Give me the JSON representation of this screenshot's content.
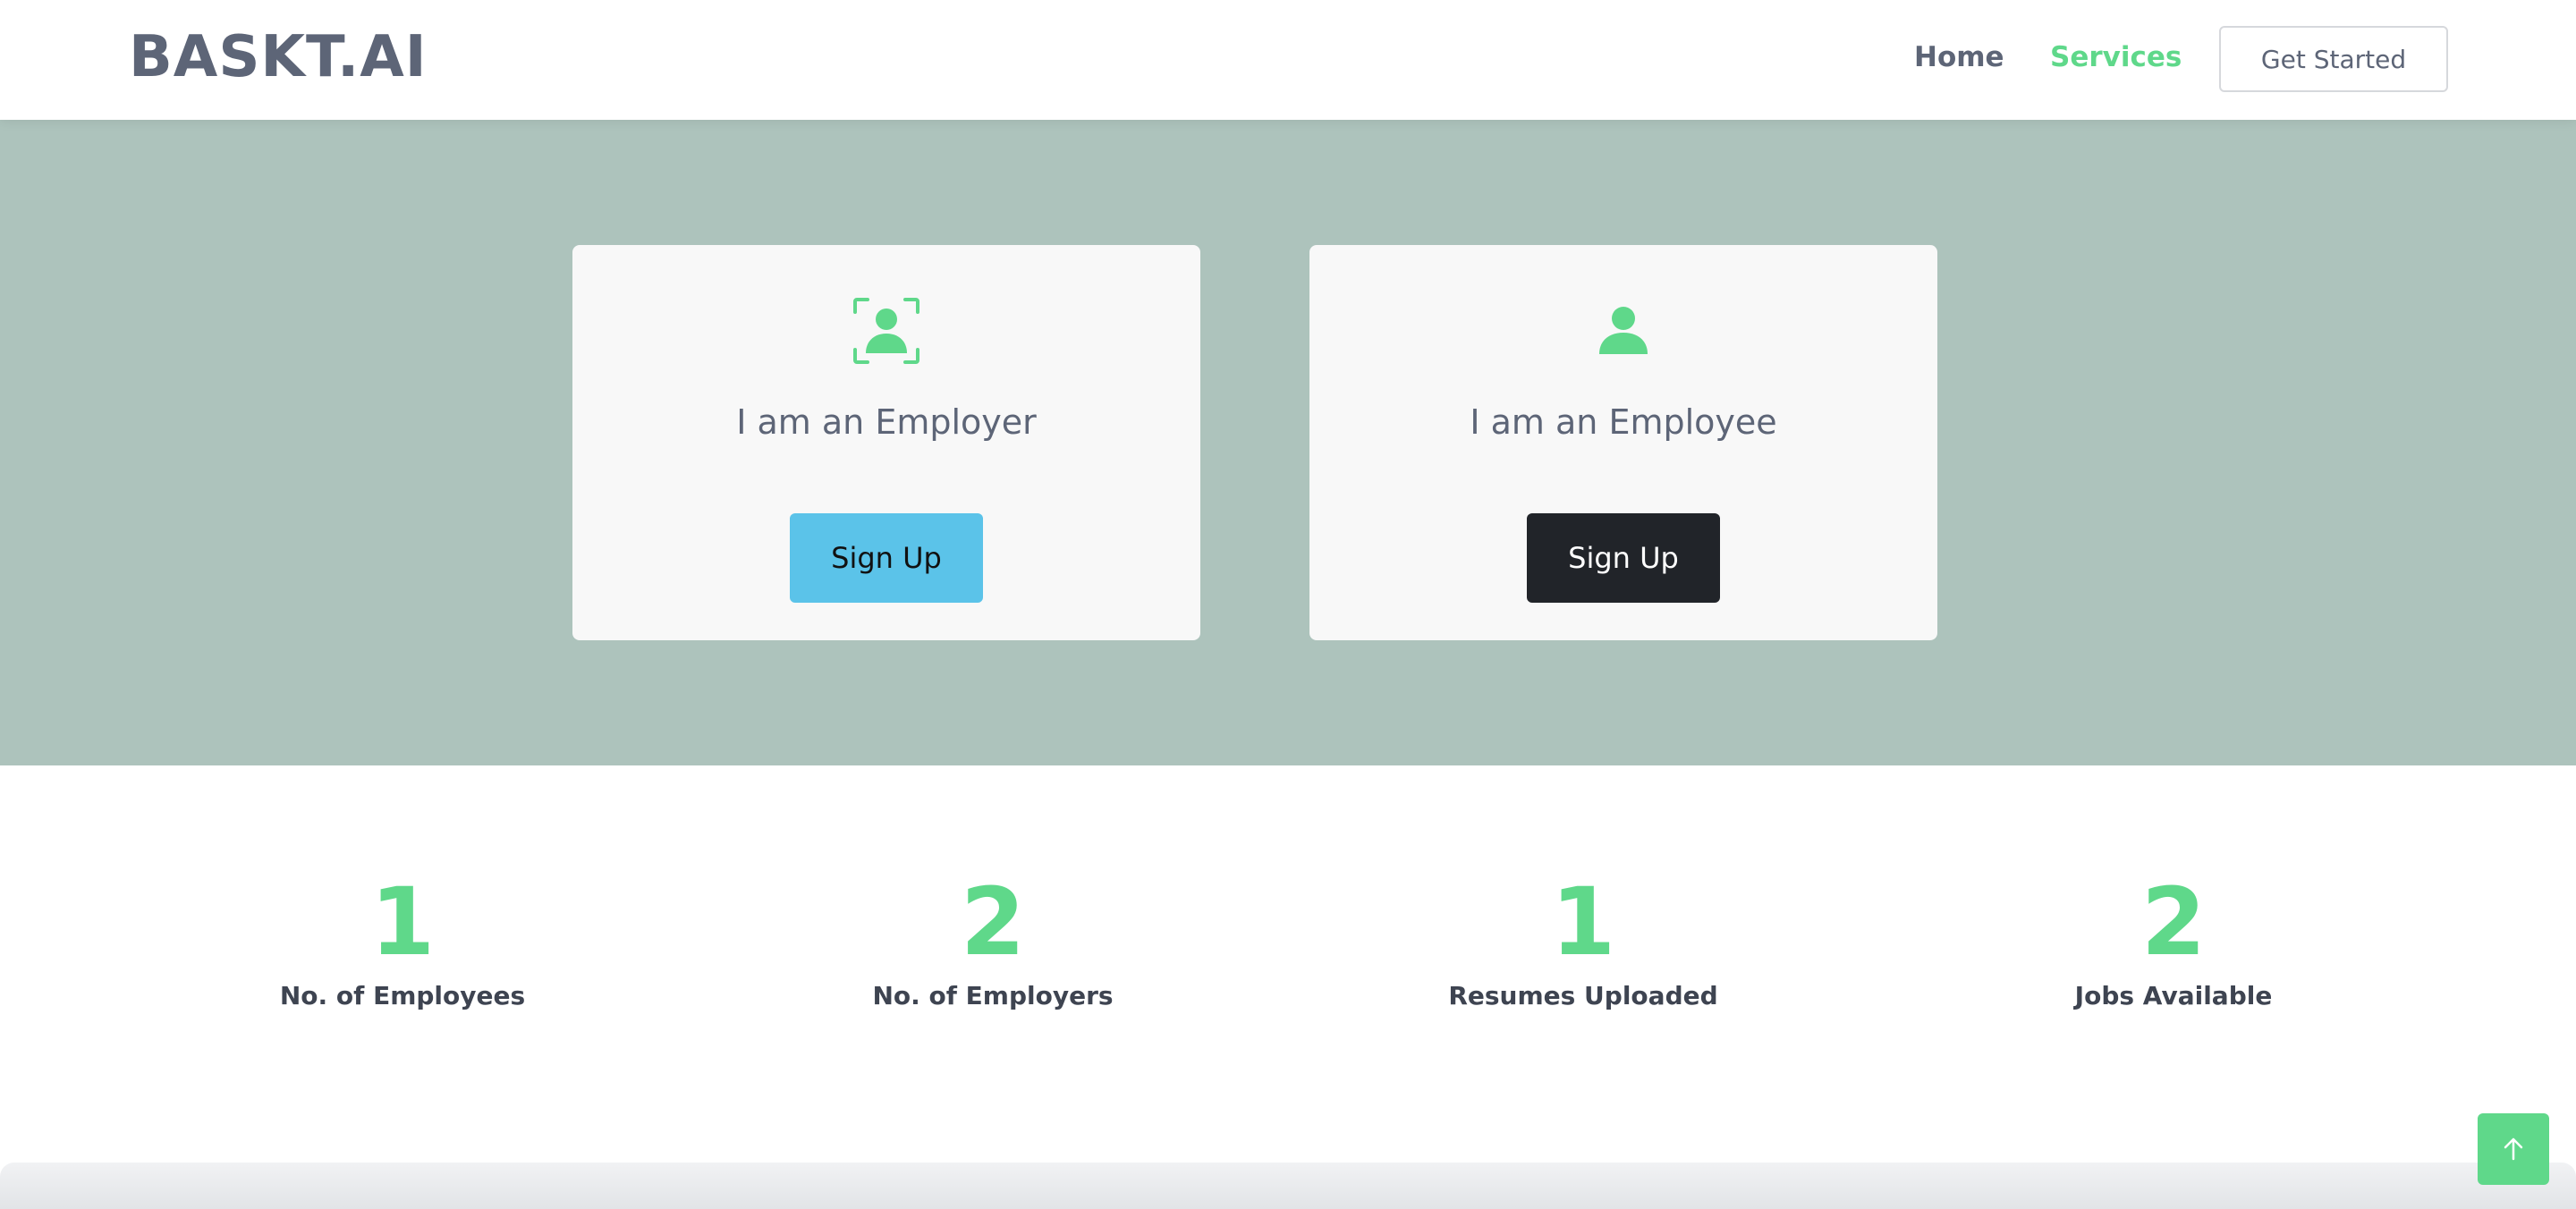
{
  "header": {
    "logo": "BASKT.AI",
    "nav": {
      "home": "Home",
      "services": "Services"
    },
    "cta_label": "Get Started",
    "active_color": "#5fd88a"
  },
  "hero": {
    "background": "#adc3bc",
    "cards": [
      {
        "icon": "user-scan-icon",
        "title": "I am an Employer",
        "button_label": "Sign Up",
        "button_color": "#5bc3e9"
      },
      {
        "icon": "user-icon",
        "title": "I am an Employee",
        "button_label": "Sign Up",
        "button_color": "#212429"
      }
    ]
  },
  "stats": [
    {
      "value": "1",
      "label": "No. of Employees"
    },
    {
      "value": "2",
      "label": "No. of Employers"
    },
    {
      "value": "1",
      "label": "Resumes Uploaded"
    },
    {
      "value": "2",
      "label": "Jobs Available"
    }
  ],
  "back_to_top": {
    "icon": "arrow-up-icon"
  }
}
